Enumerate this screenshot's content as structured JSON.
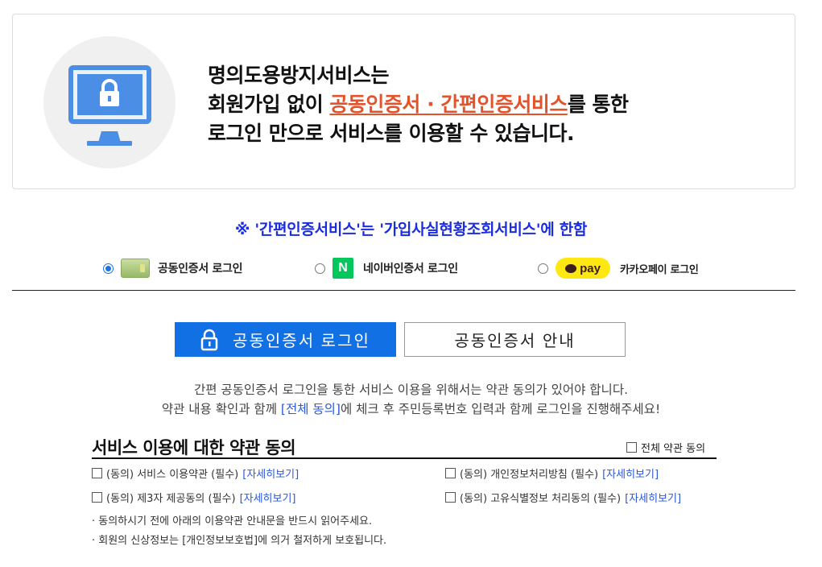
{
  "hero": {
    "line1": "명의도용방지서비스는",
    "line2_pre": "회원가입 없이 ",
    "line2_accent": "공동인증서 · 간편인증서비스",
    "line2_post": "를 통한",
    "line3": "로그인 만으로 서비스를 이용할 수 있습니다.",
    "icon": "monitor-lock-icon",
    "accent_color": "#e2522b"
  },
  "notice": "※ '간편인증서비스'는 '가입사실현황조회서비스'에 한함",
  "login_options": [
    {
      "label": "공동인증서 로그인",
      "icon": "certificate-card-icon",
      "selected": true
    },
    {
      "label": "네이버인증서 로그인",
      "icon": "naver-n-icon",
      "icon_text": "N",
      "selected": false
    },
    {
      "label": "카카오페이 로그인",
      "icon": "kakaopay-icon",
      "icon_text": "pay",
      "selected": false
    }
  ],
  "buttons": {
    "primary": "공동인증서 로그인",
    "secondary": "공동인증서 안내",
    "primary_color": "#1170e3"
  },
  "info": {
    "line1": "간편 공동인증서 로그인을 통한 서비스 이용을 위해서는 약관 동의가 있어야 합니다.",
    "line2_pre": "약관 내용 확인과 함께 ",
    "line2_link": "[전체 동의]",
    "line2_post": "에 체크 후 주민등록번호 입력과 함께 로그인을 진행해주세요!"
  },
  "terms": {
    "title": "서비스 이용에 대한 약관 동의",
    "all_agree": "전체 약관 동의",
    "items": [
      {
        "label": "(동의) 서비스 이용약관 (필수)",
        "link": "[자세히보기]"
      },
      {
        "label": "(동의) 개인정보처리방침 (필수)",
        "link": "[자세히보기]"
      },
      {
        "label": "(동의) 제3자 제공동의 (필수)",
        "link": "[자세히보기]"
      },
      {
        "label": "(동의) 고유식별정보 처리동의 (필수)",
        "link": "[자세히보기]"
      }
    ],
    "notes": [
      "· 동의하시기 전에 아래의 이용약관 안내문을 반드시 읽어주세요.",
      "· 회원의 신상정보는 [개인정보보호법]에 의거 철저하게 보호됩니다."
    ]
  }
}
